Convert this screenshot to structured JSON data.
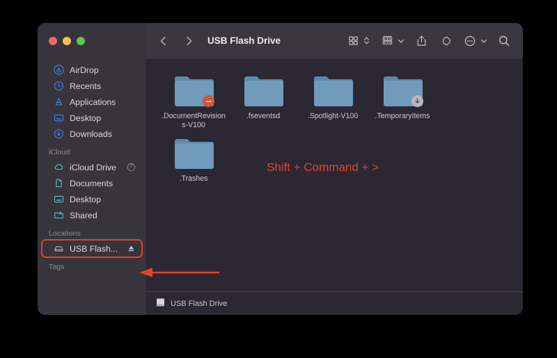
{
  "window": {
    "title": "USB Flash Drive",
    "traffic_lights": [
      "close",
      "minimize",
      "zoom"
    ]
  },
  "toolbar": {
    "back_icon": "chevron-left-icon",
    "forward_icon": "chevron-right-icon",
    "title": "USB Flash Drive",
    "view_icon": "icon-view-grid-icon",
    "view_chevron_icon": "chevron-up-down-icon",
    "group_icon": "group-by-icon",
    "group_chevron_icon": "chevron-down-icon",
    "share_icon": "share-icon",
    "tag_icon": "tag-icon",
    "more_icon": "more-ellipsis-icon",
    "more_chevron_icon": "chevron-down-icon",
    "search_icon": "search-icon"
  },
  "sidebar": {
    "favorites": [
      {
        "label": "AirDrop",
        "icon": "airdrop-icon"
      },
      {
        "label": "Recents",
        "icon": "clock-icon"
      },
      {
        "label": "Applications",
        "icon": "applications-icon"
      },
      {
        "label": "Desktop",
        "icon": "desktop-icon"
      },
      {
        "label": "Downloads",
        "icon": "downloads-icon"
      }
    ],
    "icloud_title": "iCloud",
    "icloud": [
      {
        "label": "iCloud Drive",
        "icon": "cloud-icon",
        "trailing": "sync-progress-icon"
      },
      {
        "label": "Documents",
        "icon": "document-icon",
        "trailing": ""
      },
      {
        "label": "Desktop",
        "icon": "desktop-icon",
        "trailing": ""
      },
      {
        "label": "Shared",
        "icon": "shared-folder-icon",
        "trailing": ""
      }
    ],
    "locations_title": "Locations",
    "locations": [
      {
        "label": "USB Flash...",
        "icon": "external-drive-icon",
        "trailing": "eject-icon",
        "highlighted": true
      }
    ],
    "tags_title": "Tags"
  },
  "files": [
    {
      "name": ".DocumentRevisions-V100",
      "display": ".DocumentRevisions-V100",
      "badge": "no-entry"
    },
    {
      "name": ".fseventsd",
      "display": ".fseventsd",
      "badge": ""
    },
    {
      "name": ".Spotlight-V100",
      "display": ".Spotlight-V100",
      "badge": ""
    },
    {
      "name": ".TemporaryItems",
      "display": ".TemporaryItems",
      "badge": "alias"
    },
    {
      "name": ".Trashes",
      "display": ".Trashes",
      "badge": ""
    }
  ],
  "status_bar": {
    "icon": "drive-icon",
    "label": "USB Flash Drive"
  },
  "annotations": {
    "shortcut_text": "Shift + Command + >",
    "accent_color": "#e8402a",
    "arrow": "left-arrow-annotation"
  },
  "colors": {
    "window_bg": "#2b2733",
    "sidebar_bg": "#37343c",
    "toolbar_bg": "#3a3740",
    "folder_blue": "#6e9cba",
    "icloud_teal": "#4fc4c4",
    "accent_blue": "#3b84e8",
    "annotation_red": "#e8402a"
  }
}
